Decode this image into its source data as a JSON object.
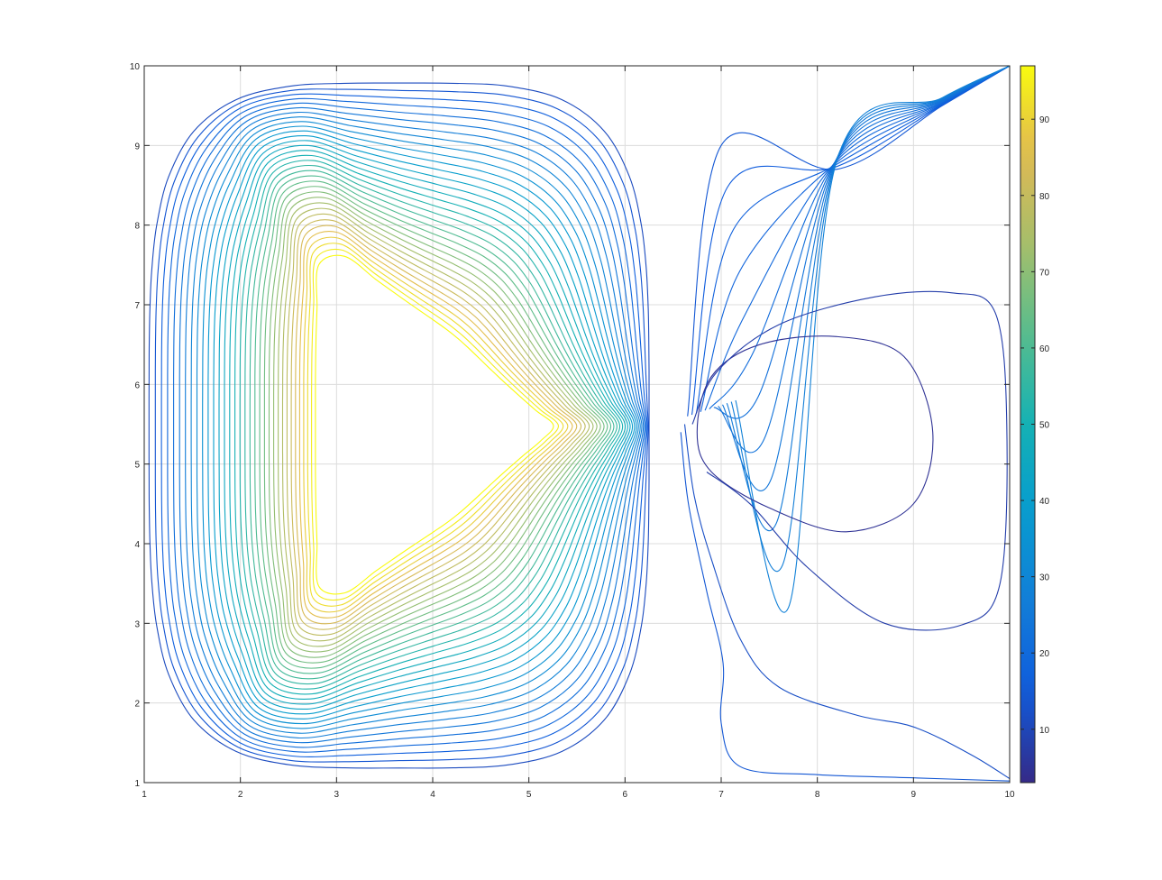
{
  "chart_data": {
    "type": "contour",
    "title": "",
    "xlabel": "",
    "ylabel": "",
    "xlim": [
      1,
      10
    ],
    "ylim": [
      1,
      10
    ],
    "grid": true,
    "x_ticks": [
      "1",
      "2",
      "3",
      "4",
      "5",
      "6",
      "7",
      "8",
      "9",
      "10"
    ],
    "y_ticks": [
      "1",
      "2",
      "3",
      "4",
      "5",
      "6",
      "7",
      "8",
      "9",
      "10"
    ],
    "colormap": "parula",
    "colorbar": {
      "range": [
        3,
        97
      ],
      "ticks": [
        "10",
        "20",
        "30",
        "40",
        "50",
        "60",
        "70",
        "80",
        "90"
      ],
      "placement": "right"
    },
    "hot_region": {
      "shape": "triangle",
      "vertices": [
        [
          2.75,
          8.05
        ],
        [
          2.75,
          2.95
        ],
        [
          5.45,
          5.45
        ]
      ],
      "level": 97
    },
    "cold_corner": {
      "x": 10,
      "y": 10
    },
    "contour_level_min": 3,
    "contour_level_max": 97,
    "contour_level_count": 38,
    "closed_low_contours": [
      {
        "level": 5,
        "points": [
          [
            6.75,
            5.4
          ],
          [
            6.9,
            6.1
          ],
          [
            7.4,
            6.5
          ],
          [
            8.2,
            6.6
          ],
          [
            8.9,
            6.35
          ],
          [
            9.2,
            5.4
          ],
          [
            9.0,
            4.5
          ],
          [
            8.3,
            4.15
          ],
          [
            7.5,
            4.45
          ],
          [
            6.9,
            4.9
          ]
        ]
      }
    ],
    "open_low_contours": [
      {
        "level": 8,
        "points": [
          [
            6.7,
            5.5
          ],
          [
            6.95,
            6.15
          ],
          [
            7.6,
            6.75
          ],
          [
            8.6,
            7.1
          ],
          [
            9.4,
            7.15
          ],
          [
            9.85,
            6.9
          ],
          [
            9.97,
            5.5
          ],
          [
            9.9,
            3.5
          ],
          [
            9.5,
            2.98
          ],
          [
            8.7,
            3.0
          ],
          [
            7.9,
            3.7
          ],
          [
            7.3,
            4.5
          ],
          [
            6.85,
            4.9
          ]
        ]
      },
      {
        "level": 12,
        "points": [
          [
            6.62,
            5.5
          ],
          [
            6.72,
            4.6
          ],
          [
            6.9,
            3.8
          ],
          [
            7.2,
            2.8
          ],
          [
            7.6,
            2.2
          ],
          [
            8.4,
            1.85
          ],
          [
            9.0,
            1.7
          ],
          [
            9.6,
            1.35
          ],
          [
            10,
            1.05
          ]
        ]
      },
      {
        "level": 14,
        "points": [
          [
            6.58,
            5.4
          ],
          [
            6.66,
            4.5
          ],
          [
            6.85,
            3.4
          ],
          [
            7.02,
            2.5
          ],
          [
            7.0,
            1.75
          ],
          [
            7.2,
            1.2
          ],
          [
            8.0,
            1.1
          ],
          [
            9.0,
            1.06
          ],
          [
            10,
            1.02
          ]
        ]
      }
    ]
  }
}
